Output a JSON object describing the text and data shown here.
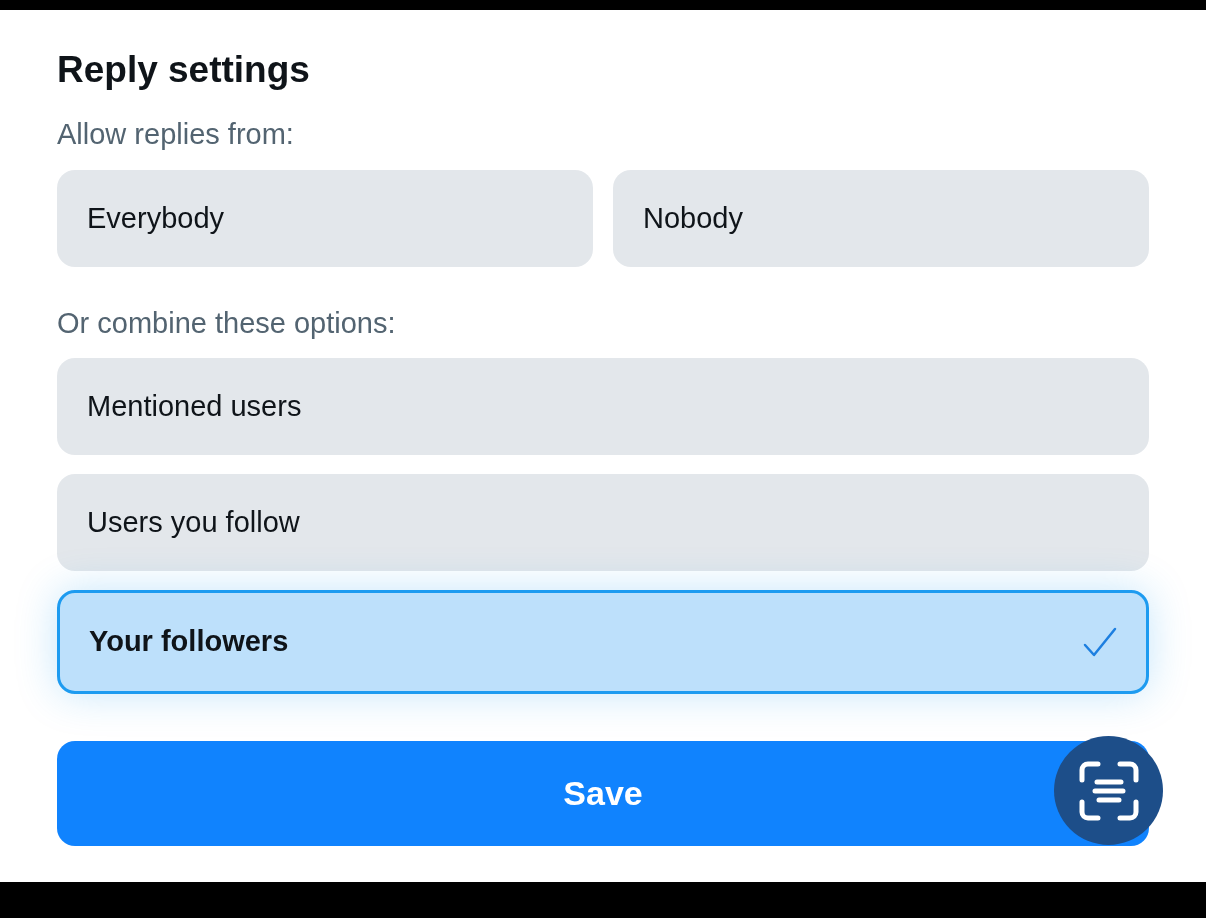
{
  "title": "Reply settings",
  "allow_label": "Allow replies from:",
  "allow_options": [
    {
      "label": "Everybody",
      "selected": false
    },
    {
      "label": "Nobody",
      "selected": false
    }
  ],
  "combine_label": "Or combine these options:",
  "combine_options": [
    {
      "label": "Mentioned users",
      "selected": false
    },
    {
      "label": "Users you follow",
      "selected": false
    },
    {
      "label": "Your followers",
      "selected": true
    }
  ],
  "save_button": "Save"
}
